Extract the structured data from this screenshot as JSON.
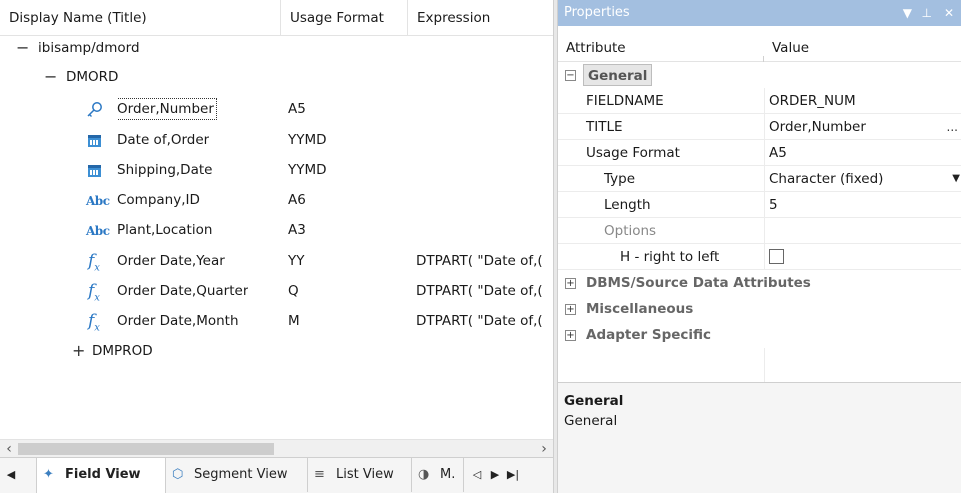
{
  "tree": {
    "columns": [
      "Display Name (Title)",
      "Usage Format",
      "Expression"
    ],
    "root": {
      "expander": "−",
      "label": "ibisamp/dmord"
    },
    "segment": {
      "expander": "−",
      "label": "DMORD"
    },
    "fields": [
      {
        "icon": "key-icon",
        "label": "Order,Number",
        "format": "A5",
        "expression": ""
      },
      {
        "icon": "calendar-icon",
        "label": "Date of,Order",
        "format": "YYMD",
        "expression": ""
      },
      {
        "icon": "calendar-icon",
        "label": "Shipping,Date",
        "format": "YYMD",
        "expression": ""
      },
      {
        "icon": "abc-icon",
        "label": "Company,ID",
        "format": "A6",
        "expression": ""
      },
      {
        "icon": "abc-icon",
        "label": "Plant,Location",
        "format": "A3",
        "expression": ""
      },
      {
        "icon": "fx-icon",
        "label": "Order Date,Year",
        "format": "YY",
        "expression": "DTPART( \"Date of,("
      },
      {
        "icon": "fx-icon",
        "label": "Order Date,Quarter",
        "format": "Q",
        "expression": "DTPART( \"Date of,("
      },
      {
        "icon": "fx-icon",
        "label": "Order Date,Month",
        "format": "M",
        "expression": "DTPART( \"Date of,("
      }
    ],
    "collapsed_segment": {
      "expander": "+",
      "label": "DMPROD"
    },
    "abc_glyph": "Abc",
    "fx_glyph": "f",
    "fx_sub": "x"
  },
  "tabs": {
    "field_view": "Field View",
    "segment_view": "Segment View",
    "list_view": "List View",
    "truncated": "M."
  },
  "properties": {
    "title": "Properties",
    "columns": {
      "attribute": "Attribute",
      "value": "Value"
    },
    "general_label": "General",
    "rows": [
      {
        "name": "FIELDNAME",
        "value": "ORDER_NUM"
      },
      {
        "name": "TITLE",
        "value": "Order,Number",
        "button": "..."
      },
      {
        "name": "Usage Format",
        "value": "A5"
      },
      {
        "name": "Type",
        "value": "Character (fixed)"
      },
      {
        "name": "Length",
        "value": "5"
      },
      {
        "name": "Options",
        "value": ""
      },
      {
        "name": "H - right to left",
        "value": ""
      }
    ],
    "collapsed_categories": [
      "DBMS/Source Data Attributes",
      "Miscellaneous",
      "Adapter Specific"
    ],
    "description": {
      "title": "General",
      "text": "General"
    }
  }
}
